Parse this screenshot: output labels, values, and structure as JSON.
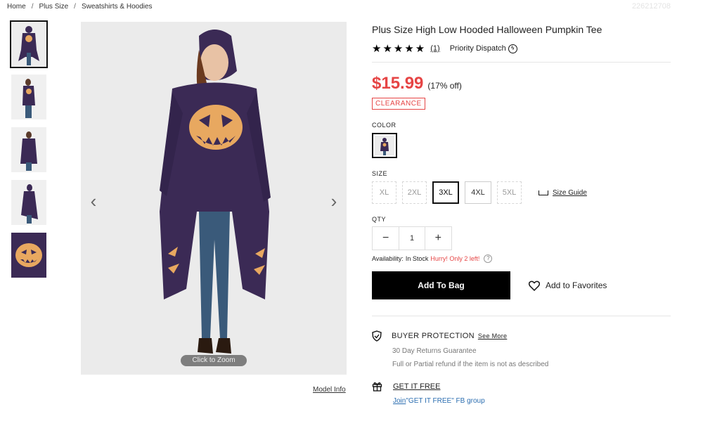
{
  "breadcrumb": {
    "home": "Home",
    "sep": "/",
    "plus_size": "Plus Size",
    "category": "Sweatshirts & Hoodies"
  },
  "sku": "226212708",
  "gallery": {
    "thumbnails": [
      "Thumbnail 1",
      "Thumbnail 2",
      "Thumbnail 3",
      "Thumbnail 4",
      "Thumbnail 5"
    ],
    "prev_arrow": "‹",
    "next_arrow": "›",
    "zoom_label": "Click to Zoom",
    "model_info": "Model Info"
  },
  "product": {
    "title": "Plus Size High Low Hooded Halloween Pumpkin Tee",
    "stars": "★★★★★",
    "review_count": "(1)",
    "priority": "Priority Dispatch",
    "price": "$15.99",
    "discount": "(17% off)",
    "badge": "CLEARANCE"
  },
  "options": {
    "color_label": "COLOR",
    "size_label": "SIZE",
    "sizes": [
      "XL",
      "2XL",
      "3XL",
      "4XL",
      "5XL"
    ],
    "selected_size": "3XL",
    "size_guide": "Size Guide",
    "qty_label": "QTY",
    "qty_minus": "−",
    "qty_value": "1",
    "qty_plus": "+",
    "availability_prefix": "Availability:",
    "availability_status": "In Stock",
    "hurry": "Hurry! Only 2 left!",
    "help": "?"
  },
  "actions": {
    "add_to_bag": "Add To Bag",
    "add_to_favorites": "Add to Favorites"
  },
  "protection": {
    "title": "BUYER PROTECTION",
    "see_more": "See More",
    "line1": "30 Day Returns Guarantee",
    "line2": "Full or Partial refund if the item is not as described"
  },
  "free": {
    "title": "GET IT FREE",
    "join": "Join",
    "group": "\"GET IT FREE\" FB group"
  },
  "colors": {
    "price": "#e64545",
    "button": "#000000",
    "product_purple": "#3b2a55",
    "pumpkin": "#e8a860"
  }
}
